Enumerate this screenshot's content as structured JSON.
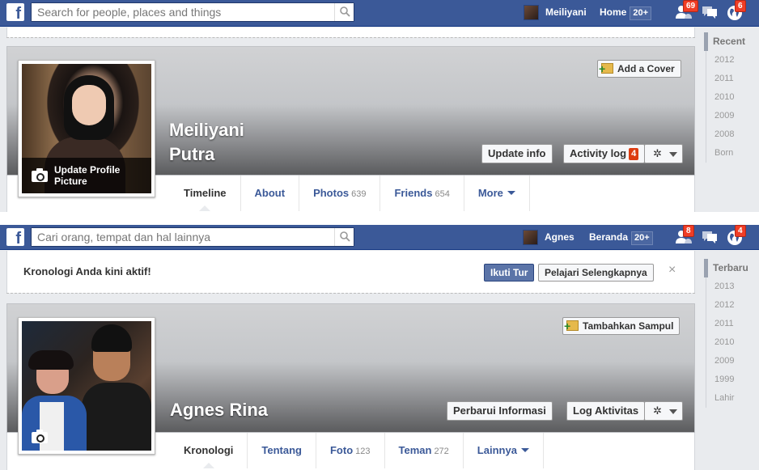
{
  "colors": {
    "facebook_blue": "#3b5998",
    "badge_red": "#f03d25"
  },
  "panel1": {
    "search": {
      "placeholder": "Search for people, places and things"
    },
    "user": {
      "name": "Meiliyani"
    },
    "home": {
      "label": "Home",
      "count": "20+"
    },
    "jewels": {
      "friends_badge": "69",
      "messages_badge": "",
      "notifications_badge": "6"
    },
    "cover": {
      "add_cover_label": "Add a Cover"
    },
    "profile": {
      "name_line1": "Meiliyani",
      "name_line2": "Putra",
      "update_picture_label": "Update Profile Picture"
    },
    "actions": {
      "update_info": "Update info",
      "activity_log": "Activity log",
      "activity_count": "4"
    },
    "tabs": [
      {
        "label": "Timeline",
        "count": ""
      },
      {
        "label": "About",
        "count": ""
      },
      {
        "label": "Photos",
        "count": "639"
      },
      {
        "label": "Friends",
        "count": "654"
      },
      {
        "label": "More",
        "count": ""
      }
    ],
    "scrubber": [
      "Recent",
      "2012",
      "2011",
      "2010",
      "2009",
      "2008",
      "Born"
    ]
  },
  "panel2": {
    "search": {
      "placeholder": "Cari orang, tempat dan hal lainnya"
    },
    "user": {
      "name": "Agnes"
    },
    "home": {
      "label": "Beranda",
      "count": "20+"
    },
    "jewels": {
      "friends_badge": "8",
      "messages_badge": "",
      "notifications_badge": "4"
    },
    "notice": {
      "text": "Kronologi Anda kini aktif!",
      "tour_button": "Ikuti Tur",
      "learn_more_button": "Pelajari Selengkapnya",
      "close": "×"
    },
    "cover": {
      "add_cover_label": "Tambahkan Sampul"
    },
    "profile": {
      "name": "Agnes Rina"
    },
    "actions": {
      "update_info": "Perbarui Informasi",
      "activity_log": "Log Aktivitas"
    },
    "tabs": [
      {
        "label": "Kronologi",
        "count": ""
      },
      {
        "label": "Tentang",
        "count": ""
      },
      {
        "label": "Foto",
        "count": "123"
      },
      {
        "label": "Teman",
        "count": "272"
      },
      {
        "label": "Lainnya",
        "count": ""
      }
    ],
    "scrubber": [
      "Terbaru",
      "2013",
      "2012",
      "2011",
      "2010",
      "2009",
      "1999",
      "Lahir"
    ]
  }
}
